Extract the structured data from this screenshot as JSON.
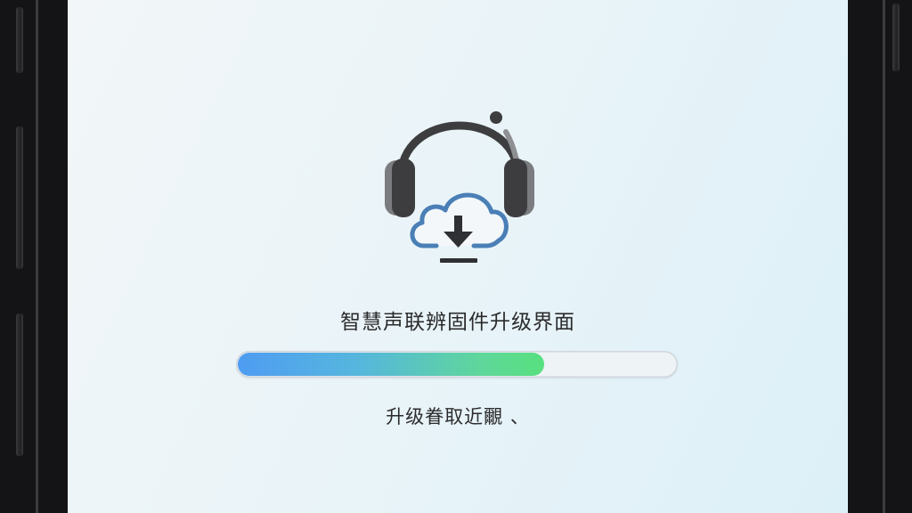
{
  "screen": {
    "title": "智慧声联辨固件升级界面",
    "status": "升级眷取近覼 、",
    "progress_percent": 70
  },
  "icons": {
    "main": "headphones-cloud-download-icon"
  },
  "colors": {
    "progress_start": "#4e9cf2",
    "progress_end": "#57e07e",
    "headphone_dark": "#3d3d40",
    "cloud_blue": "#4a7fb6"
  }
}
